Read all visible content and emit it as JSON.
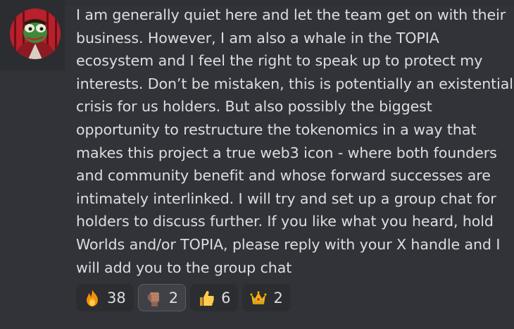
{
  "message": {
    "lines": [
      "I am generally quiet here and let the team get on with their",
      "business. However, I am also a whale in the TOPIA",
      "ecosystem and I feel the right to speak up to protect my",
      "interests. Don’t be mistaken, this is potentially an existential",
      "crisis for us holders. But also possibly the biggest",
      "opportunity to restructure the tokenomics in a way that",
      "makes this project a true web3 icon - where both founders",
      "and community benefit and whose forward successes are",
      "intimately interlinked. I will try and set up a group chat for",
      "holders to discuss further. If you like what you heard, hold",
      "Worlds and/or TOPIA, please reply with your X handle and I",
      "will add you to the group chat"
    ]
  },
  "reactions": [
    {
      "emoji": "fire-icon",
      "count": "38",
      "selected": false
    },
    {
      "emoji": "fist-icon",
      "count": "2",
      "selected": true
    },
    {
      "emoji": "thumbs-up-icon",
      "count": "6",
      "selected": false
    },
    {
      "emoji": "crown-icon",
      "count": "2",
      "selected": false
    }
  ],
  "colors": {
    "background": "#313338",
    "text": "#dbdee1",
    "reaction_bg": "#2b2d31",
    "reaction_selected_bg": "#3f4147"
  }
}
